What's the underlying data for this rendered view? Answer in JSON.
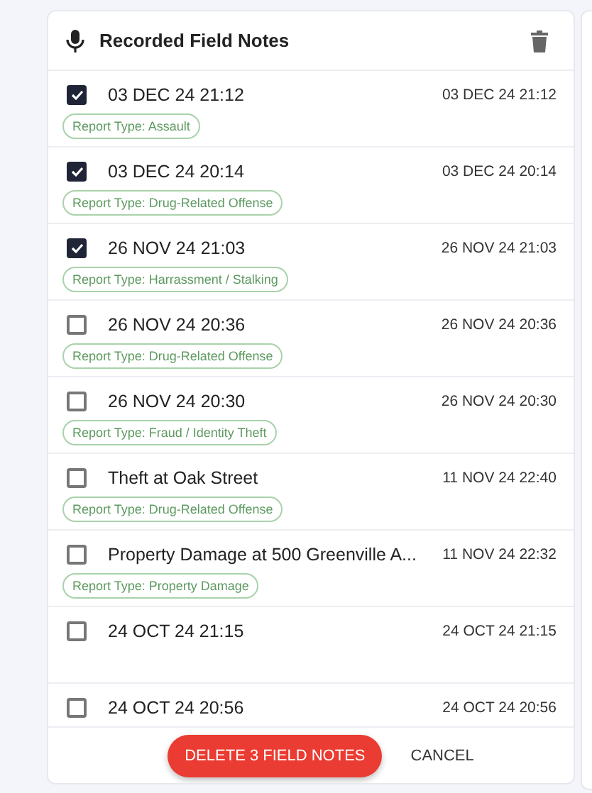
{
  "header": {
    "title": "Recorded Field Notes"
  },
  "notes": [
    {
      "title": "03 DEC 24 21:12",
      "date": "03 DEC 24 21:12",
      "tag": "Report Type: Assault",
      "checked": true
    },
    {
      "title": "03 DEC 24 20:14",
      "date": "03 DEC 24 20:14",
      "tag": "Report Type: Drug-Related Offense",
      "checked": true
    },
    {
      "title": "26 NOV 24 21:03",
      "date": "26 NOV 24 21:03",
      "tag": "Report Type: Harrassment / Stalking",
      "checked": true
    },
    {
      "title": "26 NOV 24 20:36",
      "date": "26 NOV 24 20:36",
      "tag": "Report Type: Drug-Related Offense",
      "checked": false
    },
    {
      "title": "26 NOV 24 20:30",
      "date": "26 NOV 24 20:30",
      "tag": "Report Type: Fraud / Identity Theft",
      "checked": false
    },
    {
      "title": "Theft at Oak Street",
      "date": "11 NOV 24 22:40",
      "tag": "Report Type: Drug-Related Offense",
      "checked": false
    },
    {
      "title": "Property Damage at 500 Greenville A...",
      "date": "11 NOV 24 22:32",
      "tag": "Report Type: Property Damage",
      "checked": false
    },
    {
      "title": "24 OCT 24 21:15",
      "date": "24 OCT 24 21:15",
      "checked": false
    },
    {
      "title": "24 OCT 24 20:56",
      "date": "24 OCT 24 20:56",
      "checked": false
    }
  ],
  "footer": {
    "delete_button": "DELETE 3 FIELD NOTES",
    "cancel_button": "CANCEL"
  }
}
